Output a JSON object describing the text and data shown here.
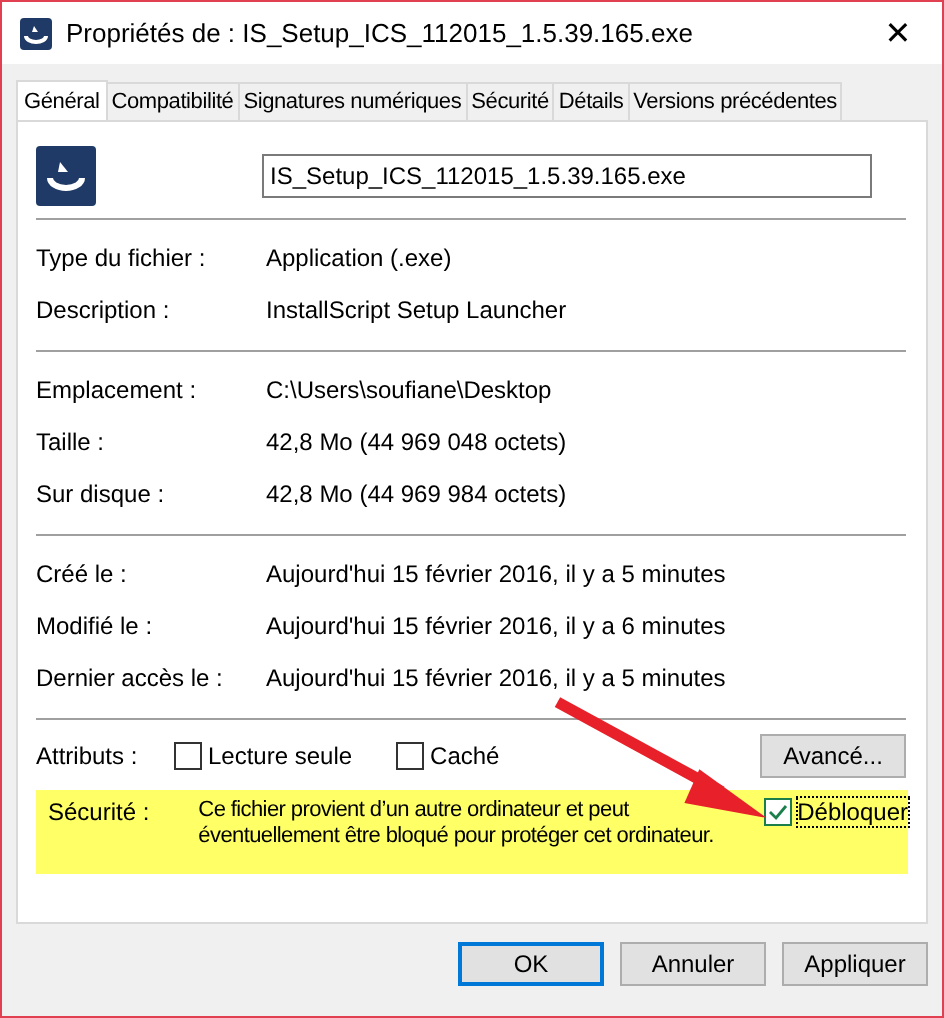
{
  "window": {
    "title": "Propriétés de : IS_Setup_ICS_112015_1.5.39.165.exe",
    "close": "✕"
  },
  "tabs": [
    {
      "label": "Général",
      "selected": true
    },
    {
      "label": "Compatibilité",
      "selected": false
    },
    {
      "label": "Signatures numériques",
      "selected": false
    },
    {
      "label": "Sécurité",
      "selected": false
    },
    {
      "label": "Détails",
      "selected": false
    },
    {
      "label": "Versions précédentes",
      "selected": false
    }
  ],
  "file_name": "IS_Setup_ICS_112015_1.5.39.165.exe",
  "groups": [
    [
      {
        "label": "Type du fichier :",
        "value": "Application (.exe)"
      },
      {
        "label": "Description :",
        "value": "InstallScript Setup Launcher"
      }
    ],
    [
      {
        "label": "Emplacement :",
        "value": "C:\\Users\\soufiane\\Desktop"
      },
      {
        "label": "Taille :",
        "value": "42,8 Mo (44 969 048 octets)"
      },
      {
        "label": "Sur disque :",
        "value": "42,8 Mo (44 969 984 octets)"
      }
    ],
    [
      {
        "label": "Créé le :",
        "value": "Aujourd'hui 15 février 2016, il y a 5 minutes"
      },
      {
        "label": "Modifié le :",
        "value": "Aujourd'hui 15 février 2016, il y a 6 minutes"
      },
      {
        "label": "Dernier accès le :",
        "value": "Aujourd'hui 15 février 2016, il y a 5 minutes"
      }
    ]
  ],
  "attributes": {
    "label": "Attributs :",
    "checkboxes": [
      {
        "label": "Lecture seule",
        "checked": false
      },
      {
        "label": "Caché",
        "checked": false
      }
    ],
    "button": "Avancé..."
  },
  "security": {
    "label": "Sécurité :",
    "text": "Ce fichier provient d’un autre ordinateur et peut éventuellement être bloqué pour protéger cet ordinateur.",
    "checkbox": {
      "label": "Débloquer",
      "checked": true
    }
  },
  "buttons": [
    {
      "label": "OK",
      "default": true
    },
    {
      "label": "Annuler",
      "default": false
    },
    {
      "label": "Appliquer",
      "default": false
    }
  ]
}
